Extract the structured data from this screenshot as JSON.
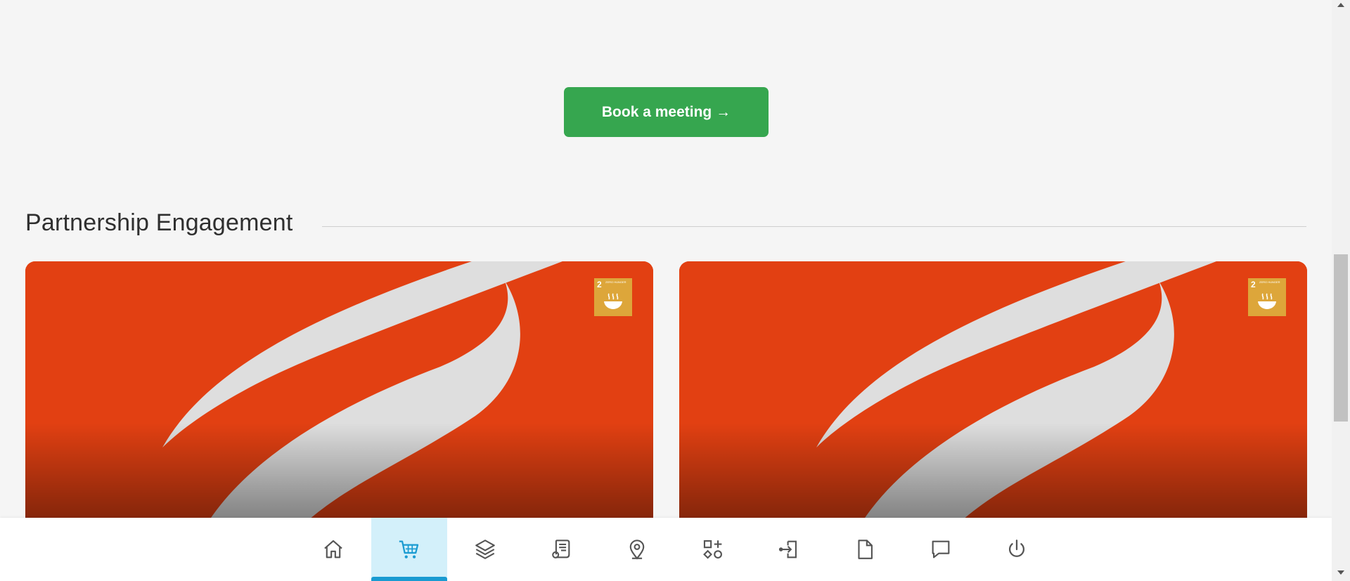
{
  "cta": {
    "label": "Book a meeting →"
  },
  "section": {
    "title": "Partnership Engagement"
  },
  "cards": [
    {
      "badge_number": "2",
      "badge_text": "ZERO HUNGER",
      "badge_color": "#dda63a",
      "background_color": "#e24012"
    },
    {
      "badge_number": "2",
      "badge_text": "ZERO HUNGER",
      "badge_color": "#dda63a",
      "background_color": "#e24012"
    }
  ],
  "bottom_nav": {
    "active_index": 1,
    "items": [
      {
        "icon": "home-icon"
      },
      {
        "icon": "cart-icon"
      },
      {
        "icon": "layers-icon"
      },
      {
        "icon": "certificate-icon"
      },
      {
        "icon": "map-pin-icon"
      },
      {
        "icon": "apps-icon"
      },
      {
        "icon": "login-icon"
      },
      {
        "icon": "file-icon"
      },
      {
        "icon": "chat-icon"
      },
      {
        "icon": "power-icon"
      }
    ]
  },
  "colors": {
    "accent": "#1a9bd1",
    "cta": "#36a64f",
    "background": "#f5f5f5"
  }
}
